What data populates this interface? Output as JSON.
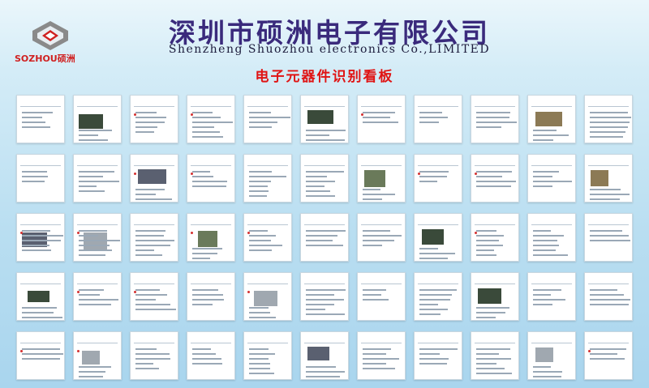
{
  "header": {
    "company_cn": "深圳市硕洲电子有限公司",
    "company_en": "Shenzheng Shuozhou electronics Co.,LIMITED",
    "board_title": "电子元器件识别看板",
    "logo_text": "SOZHOU硕洲"
  },
  "colors": {
    "title_cn": "#3a2a7c",
    "board_title": "#e01414",
    "logo_red": "#d02020",
    "logo_gray": "#7a7a7a",
    "background": "#b9def1"
  },
  "logo_icon": "sozhou-logo-icon"
}
